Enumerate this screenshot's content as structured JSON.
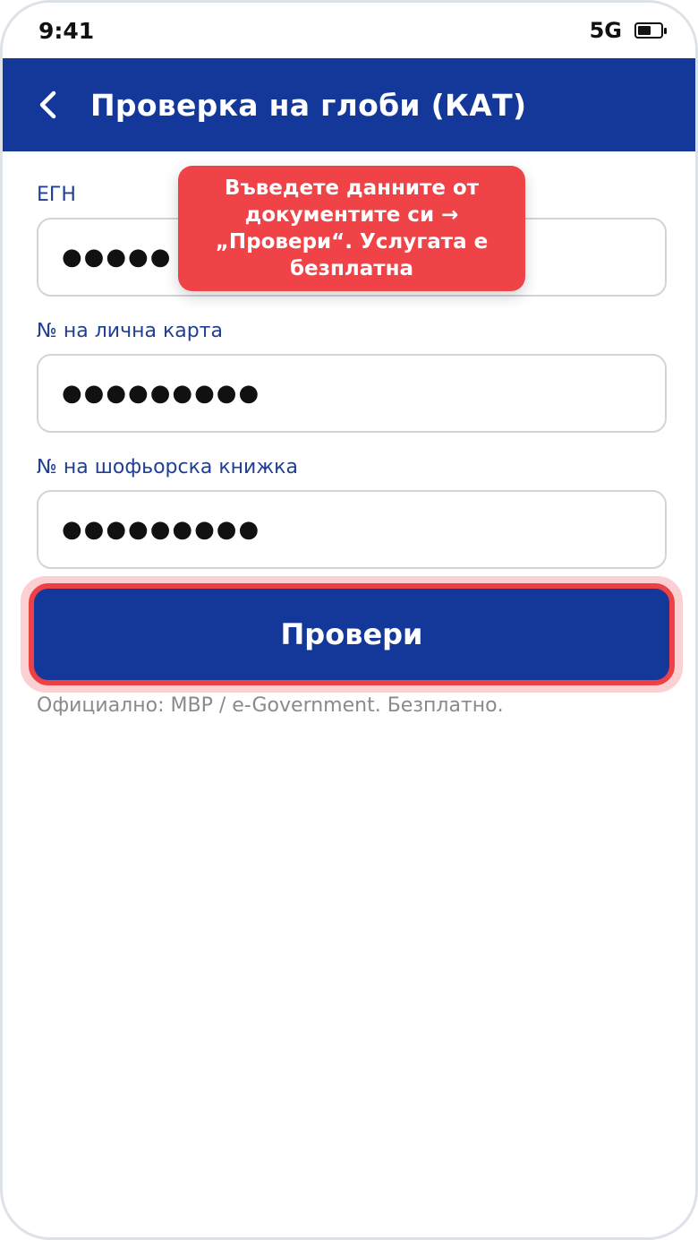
{
  "status_bar": {
    "time": "9:41",
    "network": "5G",
    "battery_icon": "battery-icon"
  },
  "app_bar": {
    "title": "Проверка на глоби (КАТ)",
    "back_icon": "chevron-left-icon"
  },
  "fields": [
    {
      "label": "ЕГН",
      "value": "●●●●●"
    },
    {
      "label": "№ на лична карта",
      "value": "●●●●●●●●●"
    },
    {
      "label": "№ на шофьорска книжка",
      "value": "●●●●●●●●●"
    }
  ],
  "check_button": {
    "label": "Провери"
  },
  "footnote": "Официално: МВР / e-Government. Безплатно.",
  "tooltip": "Въведете данните от документите си → „Провери“. Услугата е безплатна",
  "colors": {
    "primary": "#14389a",
    "accent": "#ef4348",
    "label": "#1f3f95",
    "muted": "#8a8a8a"
  }
}
